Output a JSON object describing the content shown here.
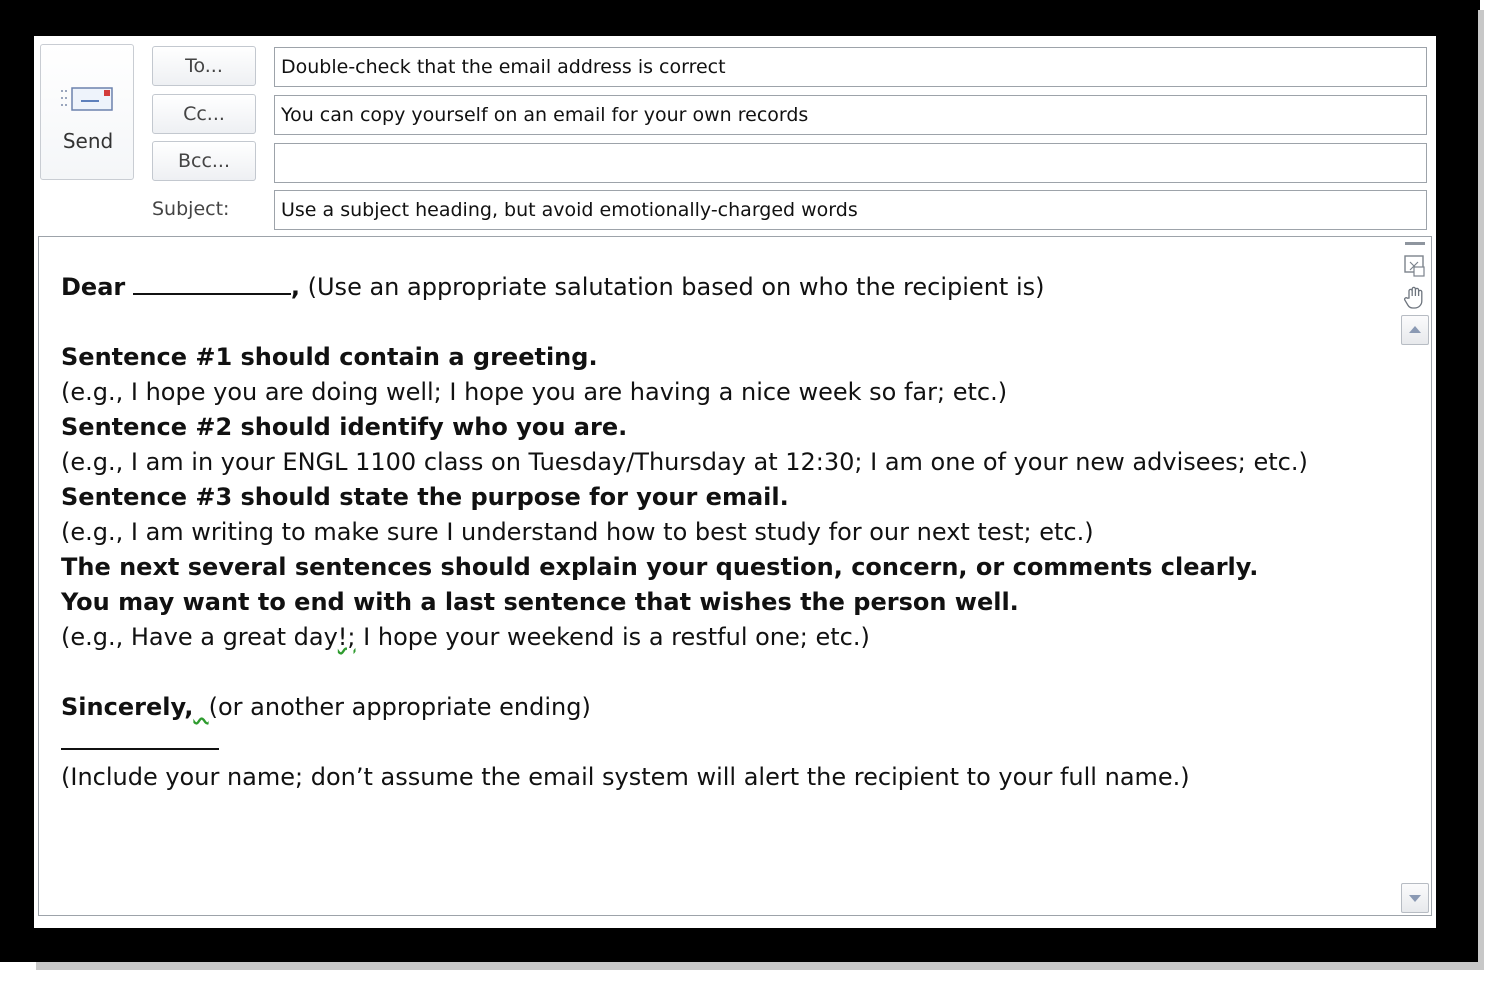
{
  "header": {
    "send_label": "Send",
    "to_label": "To...",
    "cc_label": "Cc...",
    "bcc_label": "Bcc...",
    "subject_label": "Subject:",
    "to_value": "Double-check that the email address is correct",
    "cc_value": "You can copy yourself on an email for your own records",
    "bcc_value": "",
    "subject_value": "Use a subject heading, but avoid emotionally-charged words"
  },
  "body": {
    "salutation_bold": "Dear",
    "salutation_comma": ",",
    "salutation_note": " (Use an appropriate salutation based on who the recipient is)",
    "s1": "Sentence #1 should contain a greeting.",
    "s1_eg": "(e.g., I hope you are doing well; I hope you are having a nice week so far; etc.)",
    "s2": "Sentence #2 should identify who you are.",
    "s2_eg": "(e.g., I am in your ENGL 1100 class on Tuesday/Thursday at 12:30; I am one of your new advisees; etc.)",
    "s3": "Sentence #3 should state the purpose for your email.",
    "s3_eg": "(e.g., I am writing to make sure I understand how to best study for our next test; etc.)",
    "s4": "The next several sentences should explain your question, concern, or comments clearly.",
    "s5": "You may want to end with a last sentence that wishes the person well.",
    "s5_eg_a": "(e.g., Have a great day",
    "s5_eg_b": "!;",
    "s5_eg_c": " I hope your weekend is a restful one; etc.)",
    "closing_bold": "Sincerely,",
    "closing_note": "(or another appropriate ending)",
    "name_note": "(Include your name; don’t assume the email system will alert the recipient to your full name.)"
  },
  "icons": {
    "send": "envelope-send-icon",
    "scroll_up": "scroll-up-arrow-icon",
    "scroll_down": "scroll-down-arrow-icon",
    "pan": "hand-pan-icon",
    "toggle": "toggle-view-icon"
  }
}
